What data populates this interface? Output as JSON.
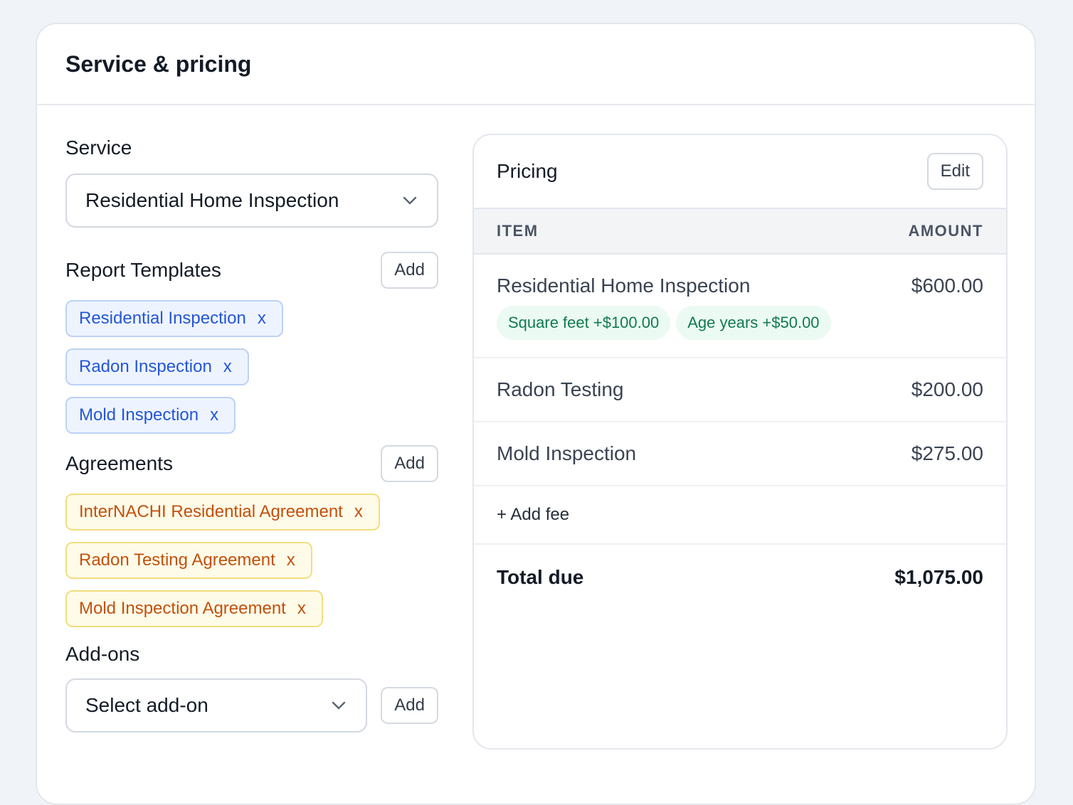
{
  "card": {
    "title": "Service & pricing"
  },
  "service": {
    "label": "Service",
    "selected": "Residential Home Inspection"
  },
  "report_templates": {
    "label": "Report Templates",
    "add_label": "Add",
    "items": [
      "Residential Inspection",
      "Radon Inspection",
      "Mold Inspection"
    ],
    "remove_glyph": "x"
  },
  "agreements": {
    "label": "Agreements",
    "add_label": "Add",
    "items": [
      "InterNACHI Residential Agreement",
      "Radon Testing Agreement",
      "Mold Inspection Agreement"
    ],
    "remove_glyph": "x"
  },
  "addons": {
    "label": "Add-ons",
    "placeholder": "Select add-on",
    "add_label": "Add"
  },
  "pricing": {
    "title": "Pricing",
    "edit_label": "Edit",
    "columns": {
      "item": "ITEM",
      "amount": "AMOUNT"
    },
    "lines": [
      {
        "name": "Residential Home Inspection",
        "amount": "$600.00",
        "modifiers": [
          "Square feet +$100.00",
          "Age years +$50.00"
        ]
      },
      {
        "name": "Radon Testing",
        "amount": "$200.00"
      },
      {
        "name": "Mold Inspection",
        "amount": "$275.00"
      }
    ],
    "add_fee_label": "+ Add fee",
    "total_label": "Total due",
    "total_amount": "$1,075.00"
  },
  "colors": {
    "template_chip_text": "#2457d6",
    "agreement_chip_text": "#c2510d",
    "modifier_chip_text": "#117a52"
  },
  "icons": {
    "dropdown": "chevron-down-icon",
    "remove": "remove-x-icon"
  }
}
